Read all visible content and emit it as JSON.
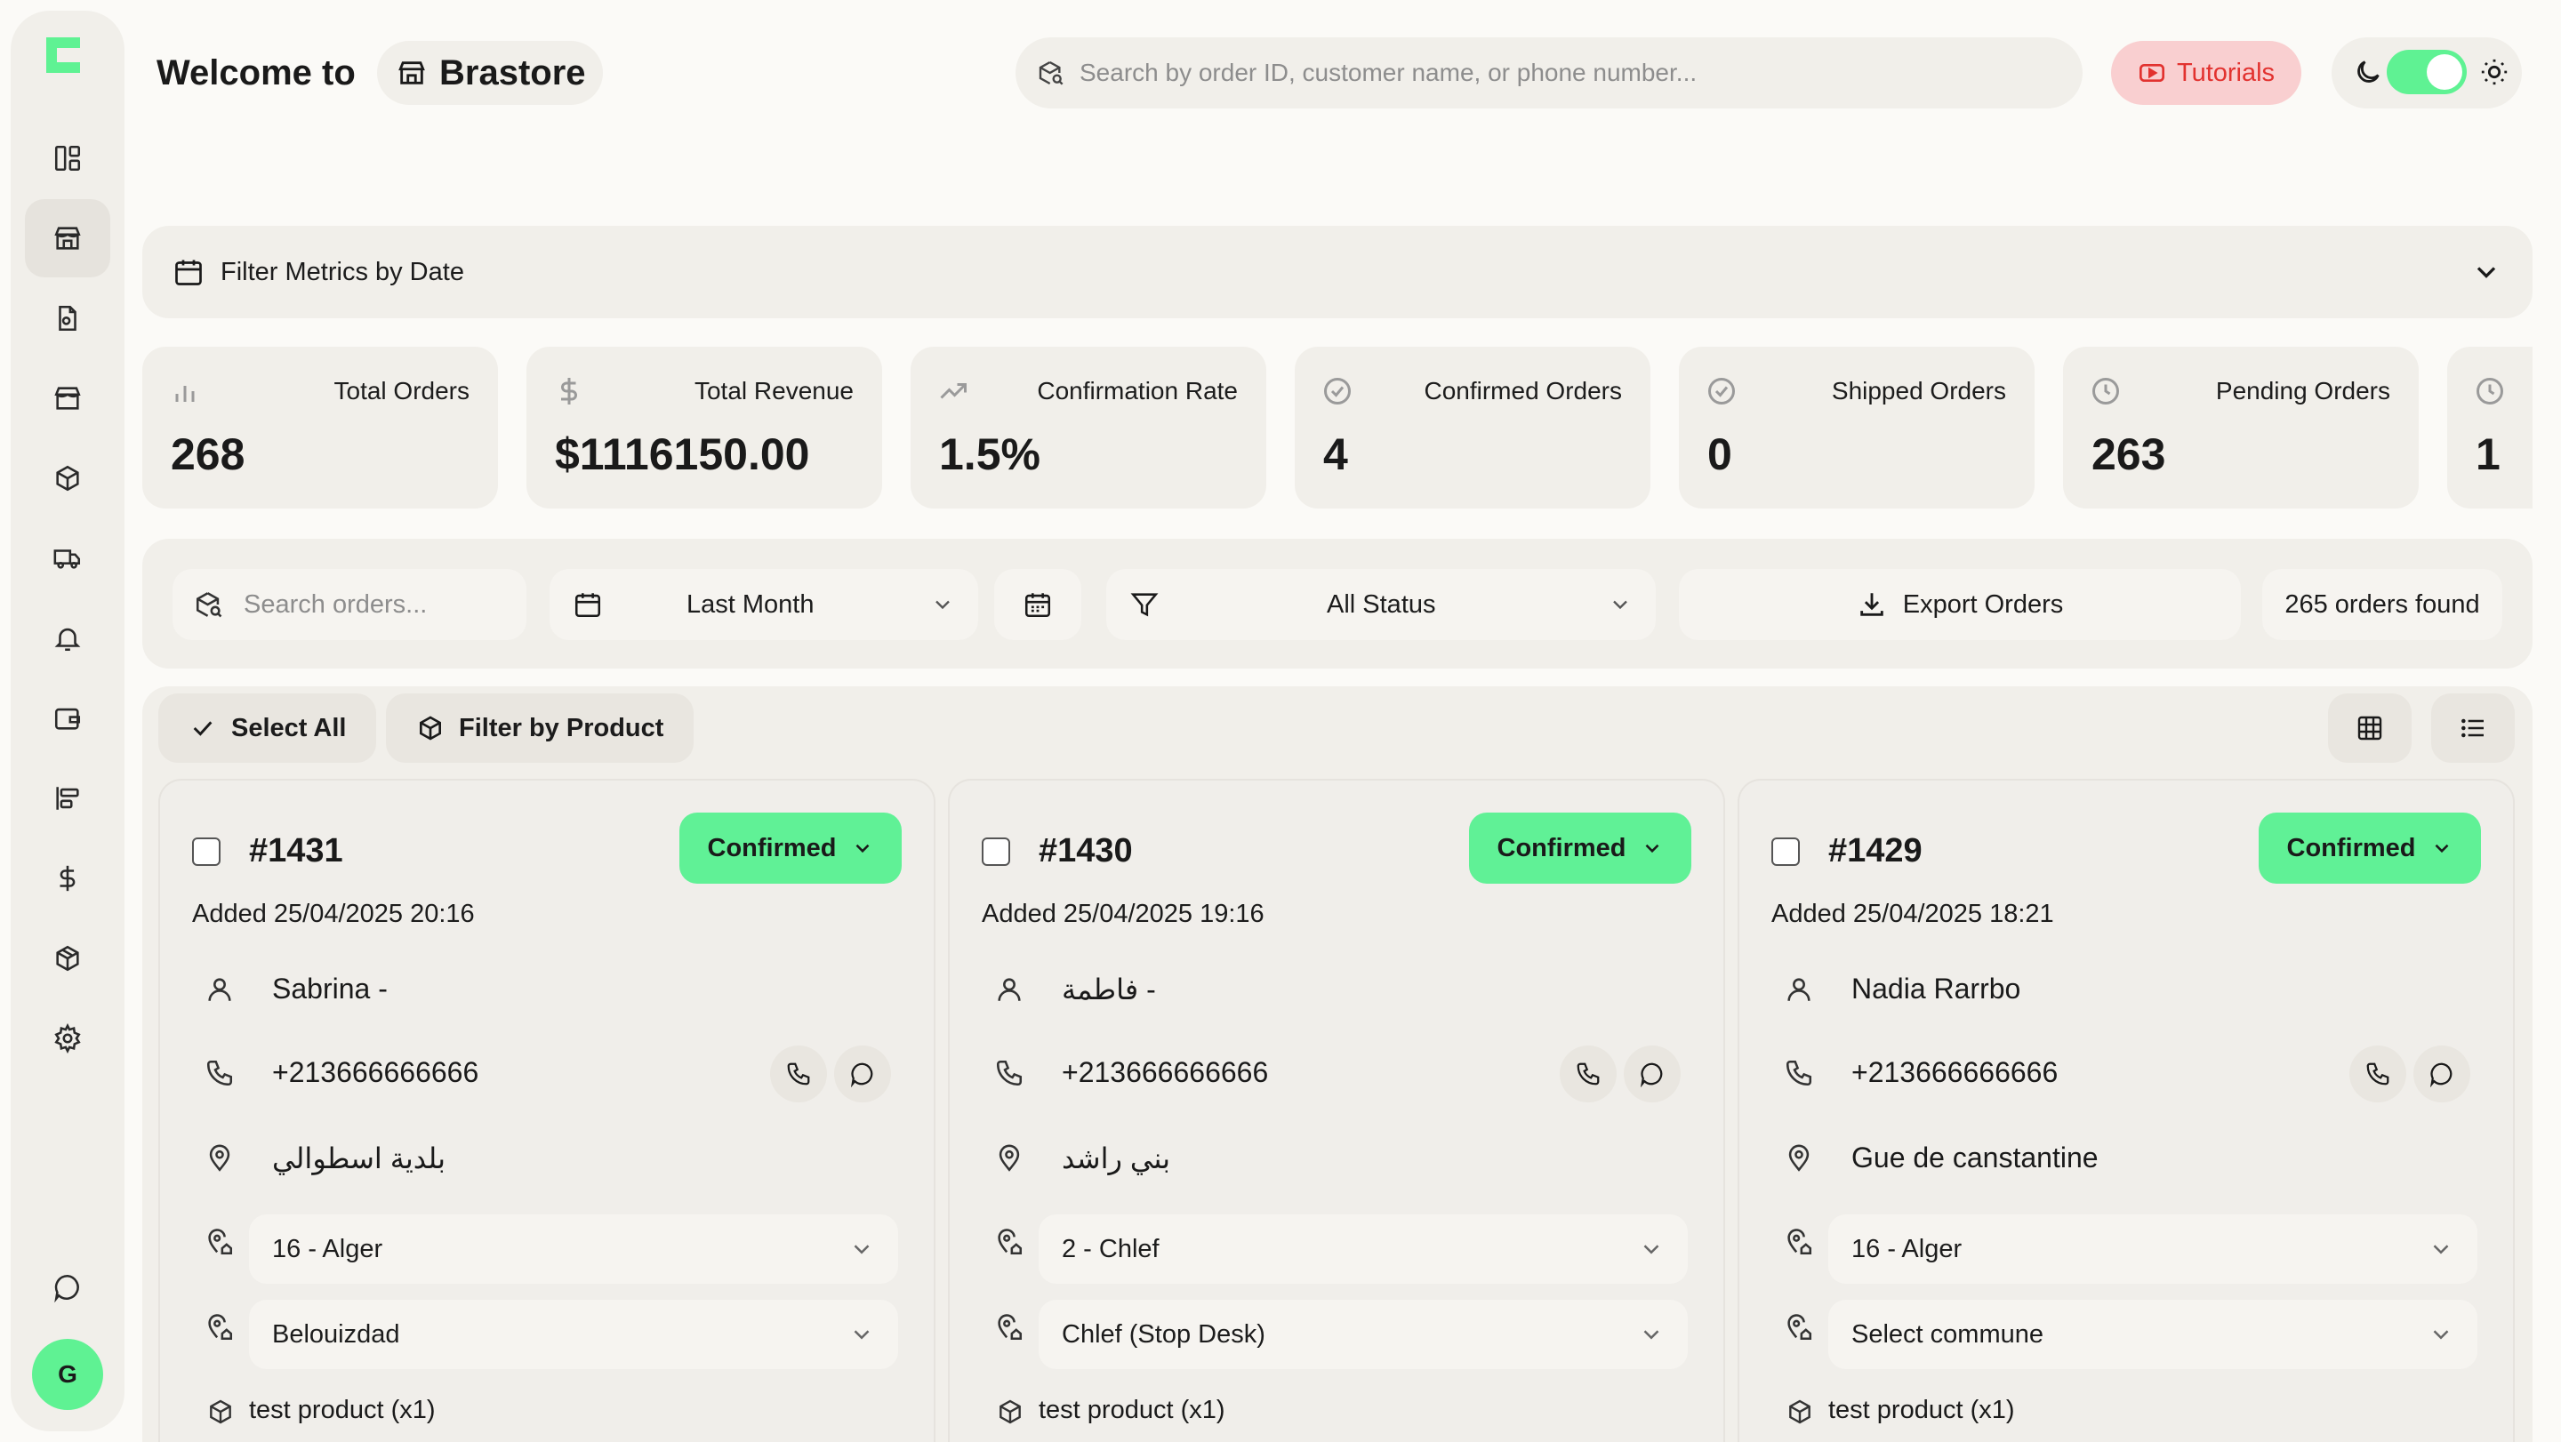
{
  "colors": {
    "accent_green": "#5ff293",
    "tutorial_red": "#e2322f",
    "panel": "#f1efea"
  },
  "sidebar": {
    "items": [
      {
        "icon": "dashboard-icon"
      },
      {
        "icon": "store-icon",
        "active": true
      },
      {
        "icon": "document-icon"
      },
      {
        "icon": "shop-icon"
      },
      {
        "icon": "package-icon"
      },
      {
        "icon": "truck-icon"
      },
      {
        "icon": "bell-icon"
      },
      {
        "icon": "wallet-icon"
      },
      {
        "icon": "align-left-icon"
      },
      {
        "icon": "dollar-icon"
      },
      {
        "icon": "boxes-icon"
      },
      {
        "icon": "settings-icon"
      }
    ],
    "chat_icon": "chat-icon",
    "avatar_initial": "G"
  },
  "header": {
    "welcome": "Welcome to",
    "store_name": "Brastore",
    "search_placeholder": "Search by order ID, customer name, or phone number...",
    "tutorials_label": "Tutorials"
  },
  "filter_metrics_label": "Filter Metrics by Date",
  "metrics": [
    {
      "label": "Total Orders",
      "value": "268",
      "icon": "bar-chart-icon"
    },
    {
      "label": "Total Revenue",
      "value": "$1116150.00",
      "icon": "dollar-icon"
    },
    {
      "label": "Confirmation Rate",
      "value": "1.5%",
      "icon": "trending-up-icon"
    },
    {
      "label": "Confirmed Orders",
      "value": "4",
      "icon": "check-circle-icon"
    },
    {
      "label": "Shipped Orders",
      "value": "0",
      "icon": "check-circle-icon"
    },
    {
      "label": "Pending Orders",
      "value": "263",
      "icon": "clock-icon"
    },
    {
      "label": "",
      "value": "1",
      "icon": "clock-icon"
    }
  ],
  "toolbar": {
    "search_placeholder": "Search orders...",
    "date_range": "Last Month",
    "status_filter": "All Status",
    "export_label": "Export Orders",
    "count_label": "265 orders found"
  },
  "actions": {
    "select_all": "Select All",
    "filter_by_product": "Filter by Product"
  },
  "orders": [
    {
      "id": "#1431",
      "status": "Confirmed",
      "added": "Added 25/04/2025 20:16",
      "customer": "Sabrina -",
      "phone": "+213666666666",
      "address": "بلدية اسطوالي",
      "wilaya": "16 - Alger",
      "commune": "Belouizdad",
      "product": "test product (x1)"
    },
    {
      "id": "#1430",
      "status": "Confirmed",
      "added": "Added 25/04/2025 19:16",
      "customer": "فاطمة -",
      "phone": "+213666666666",
      "address": "بني راشد",
      "wilaya": "2 - Chlef",
      "commune": "Chlef (Stop Desk)",
      "product": "test product (x1)"
    },
    {
      "id": "#1429",
      "status": "Confirmed",
      "added": "Added 25/04/2025 18:21",
      "customer": "Nadia Rarrbo",
      "phone": "+213666666666",
      "address": "Gue de canstantine",
      "wilaya": "16 - Alger",
      "commune": "Select commune",
      "product": "test product (x1)"
    }
  ]
}
